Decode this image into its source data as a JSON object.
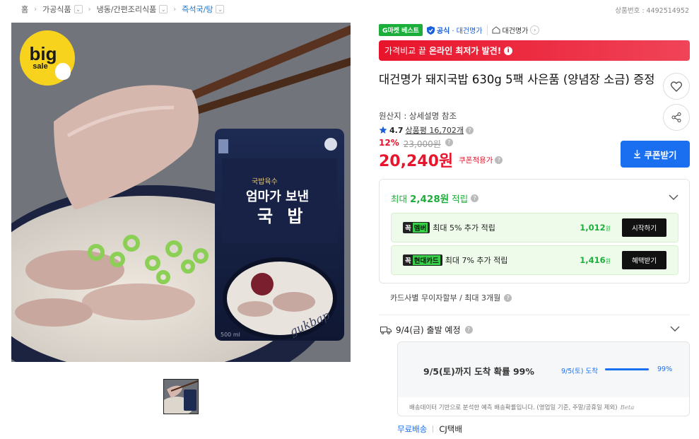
{
  "breadcrumb": {
    "home": "홈",
    "items": [
      "가공식품",
      "냉동/간편조리식품",
      "즉석국/탕"
    ]
  },
  "product_no": "상품번호 : 4492514952",
  "images": {
    "sale_badge_top": "big",
    "sale_badge_bottom": "sale",
    "package_top_label": "국밥육수",
    "package_brand": "엄마가 보낸",
    "package_name": "국 밥",
    "package_script": "gukbap",
    "package_volume": "500 ml"
  },
  "badges": {
    "best": "G마켓 베스트",
    "official_label": "공식",
    "official_seller": "· 대건명가",
    "shop_name": "대건명가"
  },
  "promo": {
    "prefix": "가격비교 끝",
    "highlight": "온라인 최저가 발견!",
    "info": "i"
  },
  "product": {
    "title": "대건명가 돼지국밥 630g 5팩 사은품 (양념장 소금) 증정",
    "origin": "원산지 : 상세설명 참조",
    "rating": "4.7",
    "review_label": "상품평",
    "review_count": "16,702개",
    "discount_rate": "12%",
    "original_price": "23,000원",
    "price": "20,240원",
    "coupon_applied": "쿠폰적용가",
    "coupon_button": "쿠폰받기"
  },
  "rewards": {
    "head_prefix": "최대",
    "head_amount": "2,428원",
    "head_suffix": "적립",
    "items": [
      {
        "tag": "꼭",
        "tag_name": "멤버",
        "text": "최대 5% 추가 적립",
        "amount": "1,012",
        "unit": "원",
        "button": "시작하기"
      },
      {
        "tag": "꼭",
        "tag_name": "현대카드",
        "text": "최대 7% 추가 적립",
        "amount": "1,416",
        "unit": "원",
        "button": "혜택받기"
      }
    ]
  },
  "installment": "카드사별 무이자할부 / 최대 3개월",
  "shipping": {
    "depart": "9/4(금) 출발 예정",
    "arrive_main": "9/5(토)까지 도착 확률 99%",
    "arrive_date": "9/5(토) 도착",
    "arrive_pct": "99%",
    "arrive_fraction": 0.99,
    "note": "배송데이터 기반으로 분석한 예측 배송확률입니다. (영업일 기준, 주말/공휴일 제외)",
    "note_brand": "Beta",
    "free": "무료배송",
    "carrier": "CJ택배"
  },
  "colors": {
    "accent_blue": "#1a6ff0",
    "price_red": "#e8142b",
    "reward_green": "#1cae3a"
  }
}
